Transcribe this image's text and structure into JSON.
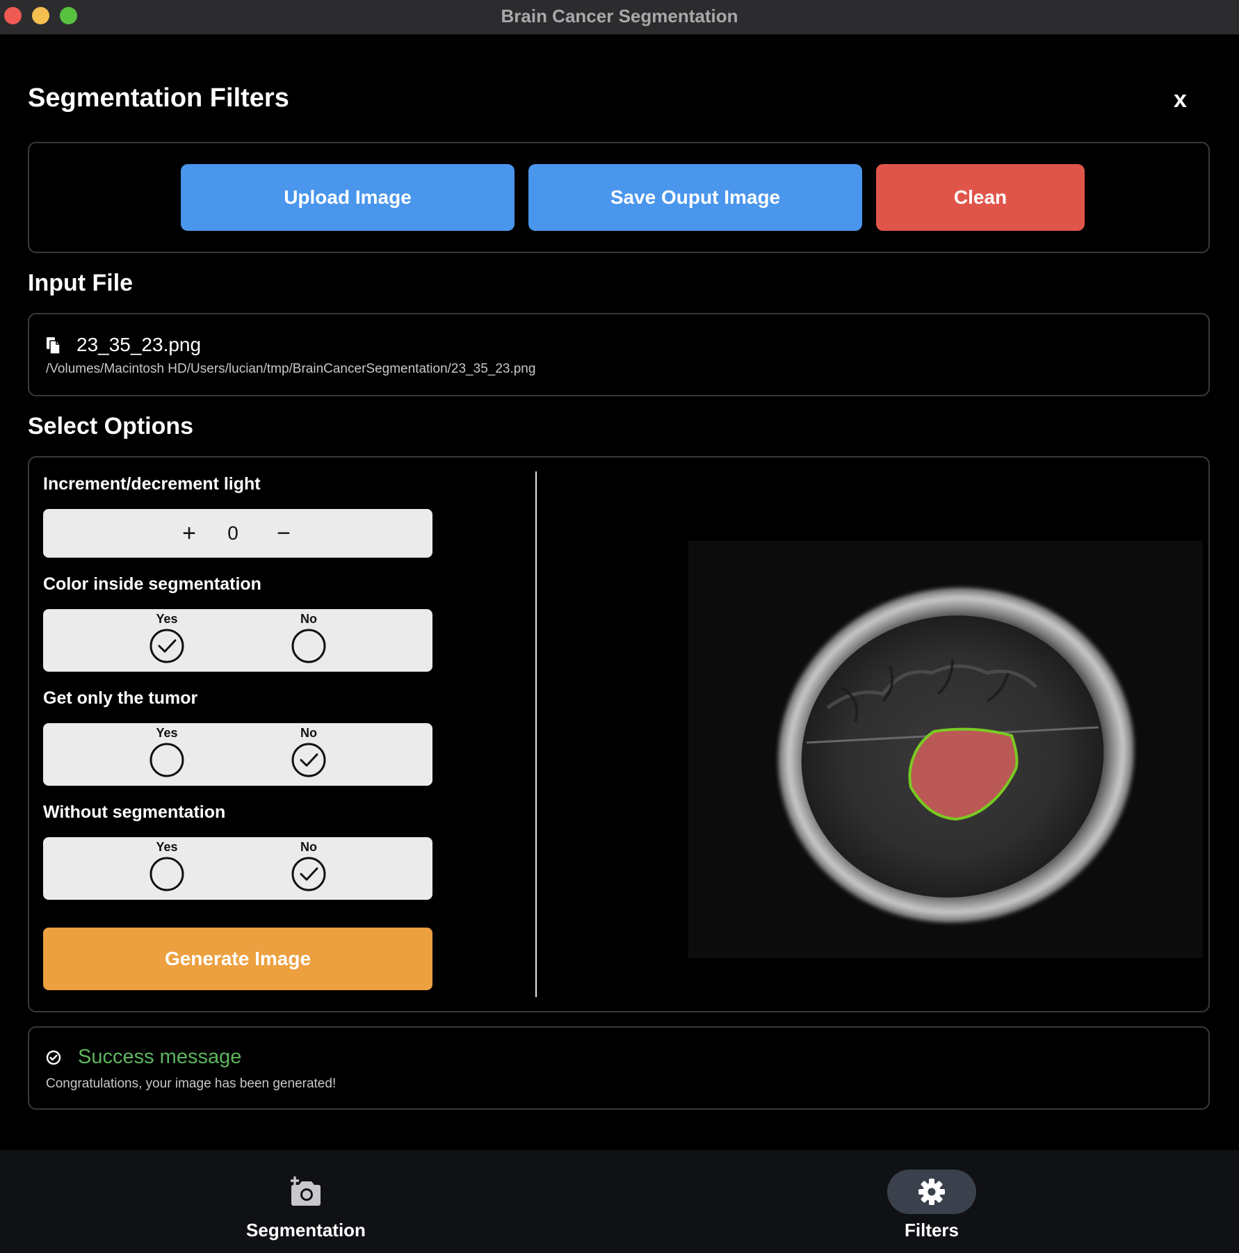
{
  "window": {
    "title": "Brain Cancer Segmentation"
  },
  "header": {
    "title": "Segmentation Filters",
    "close_label": "x"
  },
  "actions": {
    "upload_label": "Upload Image",
    "save_label": "Save Ouput Image",
    "clean_label": "Clean"
  },
  "input_file": {
    "heading": "Input File",
    "name": "23_35_23.png",
    "path": "/Volumes/Macintosh HD/Users/lucian/tmp/BrainCancerSegmentation/23_35_23.png"
  },
  "options": {
    "heading": "Select Options",
    "light": {
      "label": "Increment/decrement light",
      "plus": "+",
      "minus": "−",
      "value": "0"
    },
    "color_inside": {
      "label": "Color inside segmentation",
      "yes_label": "Yes",
      "no_label": "No",
      "selected": "Yes"
    },
    "only_tumor": {
      "label": "Get only the tumor",
      "yes_label": "Yes",
      "no_label": "No",
      "selected": "No"
    },
    "without_segmentation": {
      "label": "Without segmentation",
      "yes_label": "Yes",
      "no_label": "No",
      "selected": "No"
    },
    "generate_label": "Generate Image"
  },
  "status": {
    "title": "Success message",
    "message": "Congratulations, your image has been generated!"
  },
  "tabs": [
    {
      "label": "Segmentation",
      "icon": "camera-add-icon",
      "active": false
    },
    {
      "label": "Filters",
      "icon": "gear-icon",
      "active": true
    }
  ],
  "colors": {
    "primary_blue": "#4a96ec",
    "danger_red": "#e0554a",
    "generate_orange": "#eca03f",
    "success_green": "#5fb55f",
    "tumor_fill": "#c25a57",
    "tumor_outline": "#7ed321"
  }
}
